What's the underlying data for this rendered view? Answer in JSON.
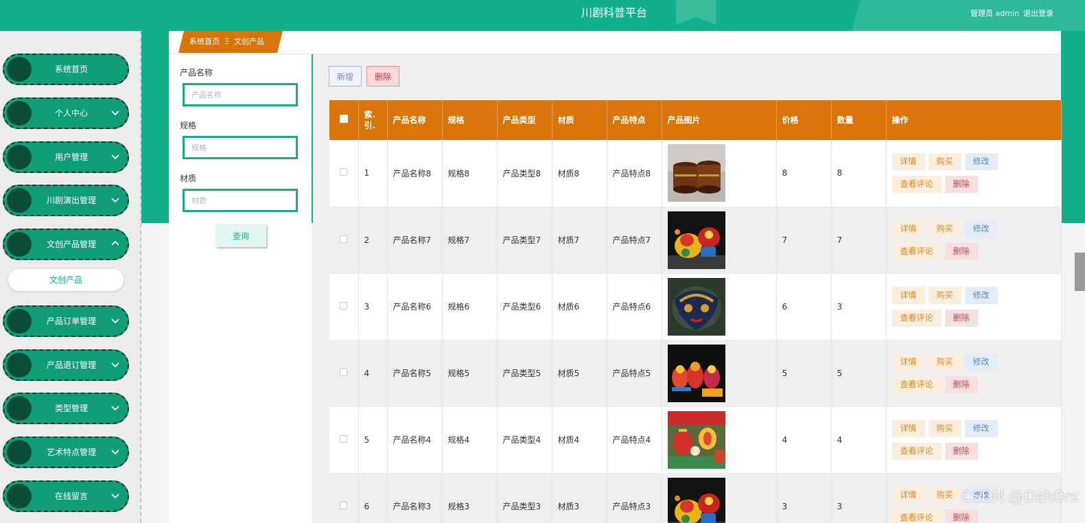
{
  "header": {
    "title": "川剧科普平台",
    "user": "管理员 admin",
    "logout": "退出登录"
  },
  "sidebar": {
    "items": [
      {
        "label": "系统首页",
        "expandable": false
      },
      {
        "label": "个人中心",
        "expandable": true
      },
      {
        "label": "用户管理",
        "expandable": true
      },
      {
        "label": "川剧演出管理",
        "expandable": true
      },
      {
        "label": "文创产品管理",
        "expandable": true,
        "expanded": true
      },
      {
        "label": "产品订单管理",
        "expandable": true
      },
      {
        "label": "产品退订管理",
        "expandable": true
      },
      {
        "label": "类型管理",
        "expandable": true
      },
      {
        "label": "艺术特点管理",
        "expandable": true
      },
      {
        "label": "在线留言",
        "expandable": true
      }
    ],
    "submenu": "文创产品"
  },
  "breadcrumb": {
    "home": "系统首页",
    "separator": "Ξ",
    "current": "文创产品"
  },
  "search": {
    "fields": [
      {
        "label": "产品名称",
        "placeholder": "产品名称",
        "value": ""
      },
      {
        "label": "规格",
        "placeholder": "规格",
        "value": ""
      },
      {
        "label": "材质",
        "placeholder": "材质",
        "value": ""
      }
    ],
    "query_button": "查询"
  },
  "toolbar": {
    "add": "新增",
    "delete": "删除"
  },
  "table": {
    "headers": [
      "索.引.",
      "产品名称",
      "规格",
      "产品类型",
      "材质",
      "产品特点",
      "产品图片",
      "价格",
      "数量",
      "操作"
    ],
    "rows": [
      {
        "index": "1",
        "name": "产品名称8",
        "spec": "规格8",
        "type": "产品类型8",
        "material": "材质8",
        "feature": "产品特点8",
        "image": "lacquer-boxes",
        "price": "8",
        "qty": "8"
      },
      {
        "index": "2",
        "name": "产品名称7",
        "spec": "规格7",
        "type": "产品类型7",
        "material": "材质7",
        "feature": "产品特点7",
        "image": "opera-figures-red",
        "price": "7",
        "qty": "7"
      },
      {
        "index": "3",
        "name": "产品名称6",
        "spec": "规格6",
        "type": "产品类型6",
        "material": "材质6",
        "feature": "产品特点6",
        "image": "opera-mask-gold",
        "price": "6",
        "qty": "3"
      },
      {
        "index": "4",
        "name": "产品名称5",
        "spec": "规格5",
        "type": "产品类型5",
        "material": "材质5",
        "feature": "产品特点5",
        "image": "opera-figures-group",
        "price": "5",
        "qty": "5"
      },
      {
        "index": "5",
        "name": "产品名称4",
        "spec": "规格4",
        "type": "产品类型4",
        "material": "材质4",
        "feature": "产品特点4",
        "image": "lanterns",
        "price": "4",
        "qty": "4"
      },
      {
        "index": "6",
        "name": "产品名称3",
        "spec": "规格3",
        "type": "产品类型3",
        "material": "材质3",
        "feature": "产品特点3",
        "image": "opera-figures-red",
        "price": "3",
        "qty": "3"
      }
    ],
    "actions": {
      "detail": "详情",
      "buy": "购买",
      "edit": "修改",
      "review": "查看评论",
      "remove": "删除"
    }
  },
  "watermark": "CSDN @Deh0rs",
  "colors": {
    "primary": "#12b08a",
    "header_orange": "#d97408",
    "dark_knob": "#0b4d36"
  }
}
